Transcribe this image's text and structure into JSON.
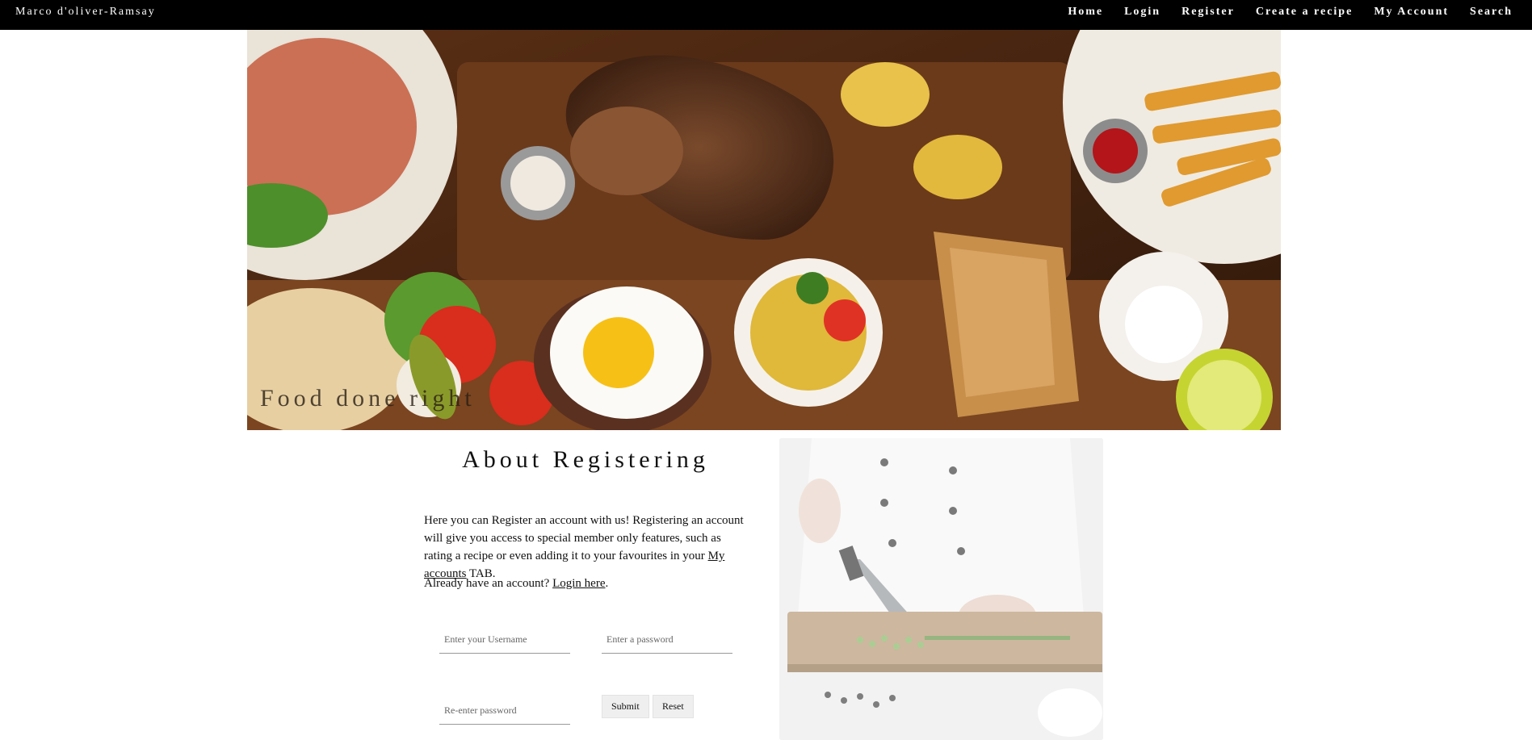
{
  "nav": {
    "brand": "Marco d'oliver-Ramsay",
    "links": [
      "Home",
      "Login",
      "Register",
      "Create a recipe",
      "My Account",
      "Search"
    ]
  },
  "hero": {
    "caption": "Food done right"
  },
  "about": {
    "title": "About Registering",
    "intro_text": "Here you can Register an account with us! Registering an account will give you access to special member only features, such as rating a recipe or even adding it to your favourites in your ",
    "intro_link": "My accounts",
    "intro_suffix": " TAB.",
    "login_prompt": "Already have an account? ",
    "login_link": "Login here",
    "login_suffix": "."
  },
  "form": {
    "username_placeholder": "Enter your Username",
    "password_placeholder": "Enter a password",
    "reenter_placeholder": "Re-enter password",
    "submit_label": "Submit",
    "reset_label": "Reset"
  }
}
